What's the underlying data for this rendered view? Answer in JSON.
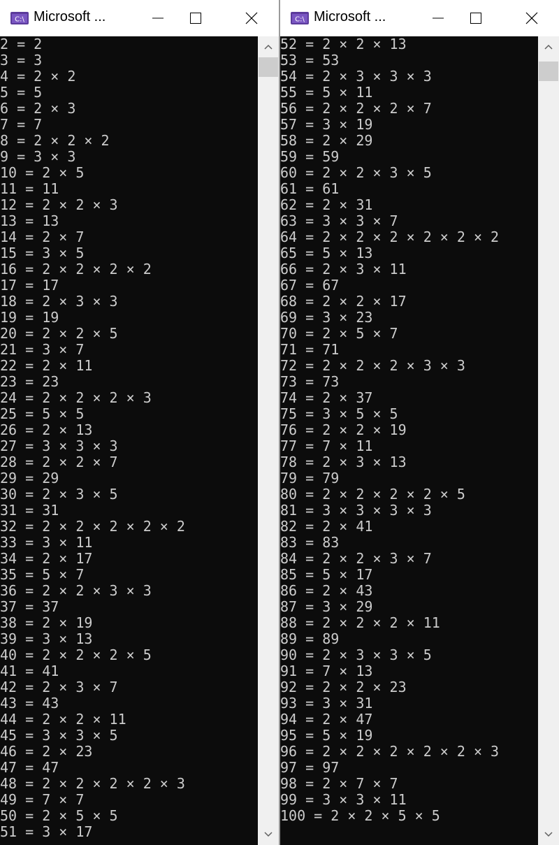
{
  "windows": [
    {
      "title": "Microsoft ...",
      "icon": "console-app-icon",
      "icon_text": "C:\\",
      "lines": [
        "2 = 2",
        "3 = 3",
        "4 = 2 × 2",
        "5 = 5",
        "6 = 2 × 3",
        "7 = 7",
        "8 = 2 × 2 × 2",
        "9 = 3 × 3",
        "10 = 2 × 5",
        "11 = 11",
        "12 = 2 × 2 × 3",
        "13 = 13",
        "14 = 2 × 7",
        "15 = 3 × 5",
        "16 = 2 × 2 × 2 × 2",
        "17 = 17",
        "18 = 2 × 3 × 3",
        "19 = 19",
        "20 = 2 × 2 × 5",
        "21 = 3 × 7",
        "22 = 2 × 11",
        "23 = 23",
        "24 = 2 × 2 × 2 × 3",
        "25 = 5 × 5",
        "26 = 2 × 13",
        "27 = 3 × 3 × 3",
        "28 = 2 × 2 × 7",
        "29 = 29",
        "30 = 2 × 3 × 5",
        "31 = 31",
        "32 = 2 × 2 × 2 × 2 × 2",
        "33 = 3 × 11",
        "34 = 2 × 17",
        "35 = 5 × 7",
        "36 = 2 × 2 × 3 × 3",
        "37 = 37",
        "38 = 2 × 19",
        "39 = 3 × 13",
        "40 = 2 × 2 × 2 × 5",
        "41 = 41",
        "42 = 2 × 3 × 7",
        "43 = 43",
        "44 = 2 × 2 × 11",
        "45 = 3 × 3 × 5",
        "46 = 2 × 23",
        "47 = 47",
        "48 = 2 × 2 × 2 × 2 × 3",
        "49 = 7 × 7",
        "50 = 2 × 5 × 5",
        "51 = 3 × 17"
      ]
    },
    {
      "title": "Microsoft ...",
      "icon": "console-app-icon",
      "icon_text": "C:\\",
      "lines": [
        "52 = 2 × 2 × 13",
        "53 = 53",
        "54 = 2 × 3 × 3 × 3",
        "55 = 5 × 11",
        "56 = 2 × 2 × 2 × 7",
        "57 = 3 × 19",
        "58 = 2 × 29",
        "59 = 59",
        "60 = 2 × 2 × 3 × 5",
        "61 = 61",
        "62 = 2 × 31",
        "63 = 3 × 3 × 7",
        "64 = 2 × 2 × 2 × 2 × 2 × 2",
        "65 = 5 × 13",
        "66 = 2 × 3 × 11",
        "67 = 67",
        "68 = 2 × 2 × 17",
        "69 = 3 × 23",
        "70 = 2 × 5 × 7",
        "71 = 71",
        "72 = 2 × 2 × 2 × 3 × 3",
        "73 = 73",
        "74 = 2 × 37",
        "75 = 3 × 5 × 5",
        "76 = 2 × 2 × 19",
        "77 = 7 × 11",
        "78 = 2 × 3 × 13",
        "79 = 79",
        "80 = 2 × 2 × 2 × 2 × 5",
        "81 = 3 × 3 × 3 × 3",
        "82 = 2 × 41",
        "83 = 83",
        "84 = 2 × 2 × 3 × 7",
        "85 = 5 × 17",
        "86 = 2 × 43",
        "87 = 3 × 29",
        "88 = 2 × 2 × 2 × 11",
        "89 = 89",
        "90 = 2 × 3 × 3 × 5",
        "91 = 7 × 13",
        "92 = 2 × 2 × 23",
        "93 = 3 × 31",
        "94 = 2 × 47",
        "95 = 5 × 19",
        "96 = 2 × 2 × 2 × 2 × 2 × 3",
        "97 = 97",
        "98 = 2 × 7 × 7",
        "99 = 3 × 3 × 11",
        "100 = 2 × 2 × 5 × 5"
      ]
    }
  ]
}
